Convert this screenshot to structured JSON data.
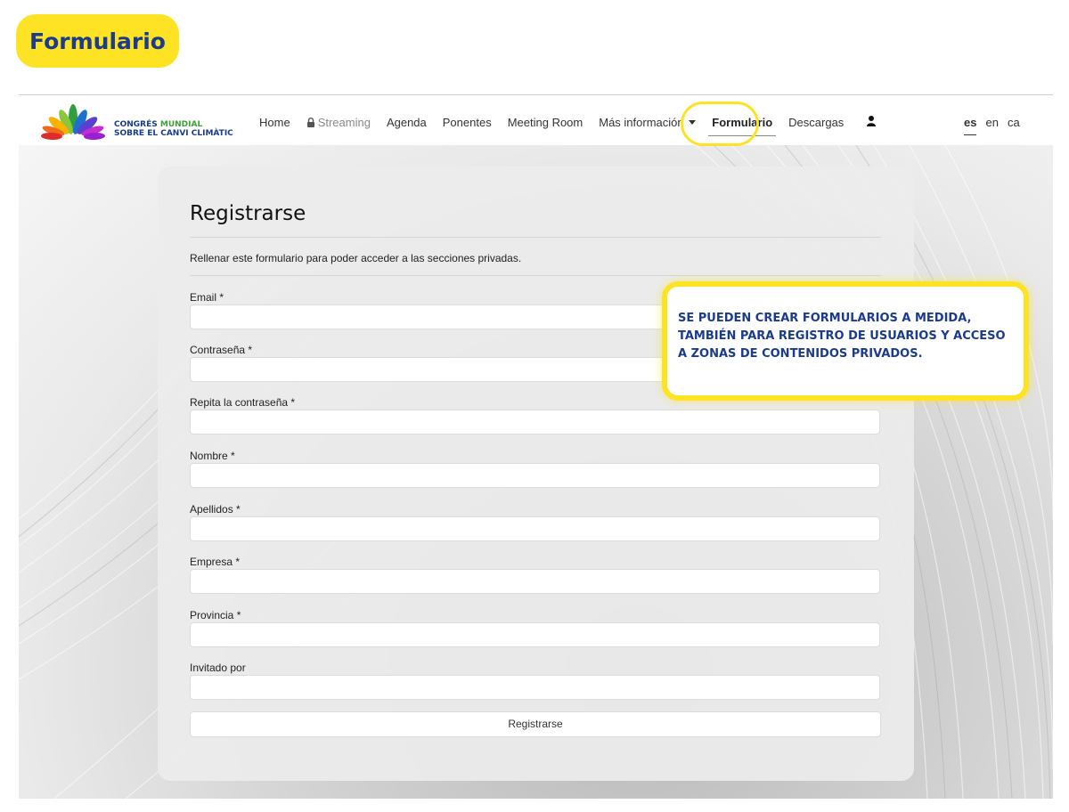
{
  "badge": {
    "label": "Formulario"
  },
  "logo": {
    "line1_part1": "CONGRÉS ",
    "line1_part2": "MUNDIAL",
    "line2": "SOBRE EL CANVI CLIMÀTIC"
  },
  "nav": {
    "home": "Home",
    "streaming": "Streaming",
    "agenda": "Agenda",
    "ponentes": "Ponentes",
    "meeting_room": "Meeting Room",
    "mas_info": "Más información",
    "formulario": "Formulario",
    "descargas": "Descargas"
  },
  "languages": {
    "es": "es",
    "en": "en",
    "ca": "ca"
  },
  "form": {
    "title": "Registrarse",
    "subtitle": "Rellenar este formulario para poder acceder a las secciones privadas.",
    "fields": [
      {
        "label": "Email *",
        "value": ""
      },
      {
        "label": "Contraseña *",
        "value": ""
      },
      {
        "label": "Repita la contraseña *",
        "value": ""
      },
      {
        "label": "Nombre *",
        "value": ""
      },
      {
        "label": "Apellidos *",
        "value": ""
      },
      {
        "label": "Empresa *",
        "value": ""
      },
      {
        "label": "Provincia *",
        "value": ""
      },
      {
        "label": "Invitado por",
        "value": ""
      }
    ],
    "submit": "Registrarse"
  },
  "callout": {
    "text": "SE PUEDEN CREAR FORMULARIOS A MEDIDA, TAMBIÉN PARA REGISTRO DE USUARIOS Y ACCESO A ZONAS DE CONTENIDOS PRIVADOS."
  },
  "colors": {
    "accent_yellow": "#fde324",
    "brand_blue": "#1b3c8c",
    "brand_green": "#3aa236"
  },
  "icons": {
    "lock": "lock-icon",
    "caret": "caret-down-icon",
    "user": "user-icon"
  }
}
